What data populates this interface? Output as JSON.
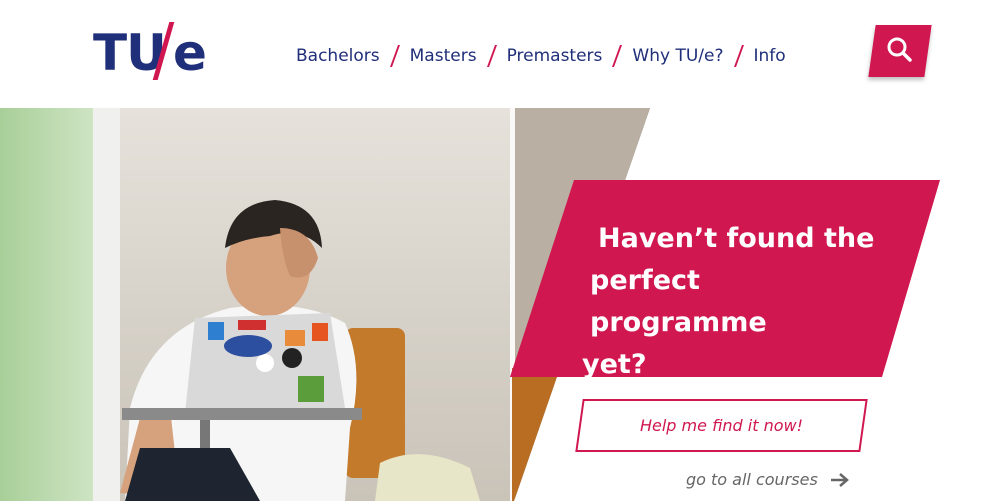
{
  "logo": {
    "letters": "TU",
    "slash": "/",
    "e": "e"
  },
  "nav": {
    "items": [
      {
        "label": "Bachelors"
      },
      {
        "label": "Masters"
      },
      {
        "label": "Premasters"
      },
      {
        "label": "Why TU/e?"
      },
      {
        "label": "Info"
      }
    ]
  },
  "search": {
    "icon": "search-icon"
  },
  "hero": {
    "title_lines": [
      "Haven’t found the",
      "perfect programme",
      "yet?"
    ],
    "cta_label": "Help me find it now!",
    "secondary_link": "go to all courses",
    "secondary_icon": "arrow-right-icon"
  },
  "colors": {
    "brand_red": "#d0174f",
    "brand_blue": "#1f2f7a",
    "muted_text": "#666666"
  }
}
